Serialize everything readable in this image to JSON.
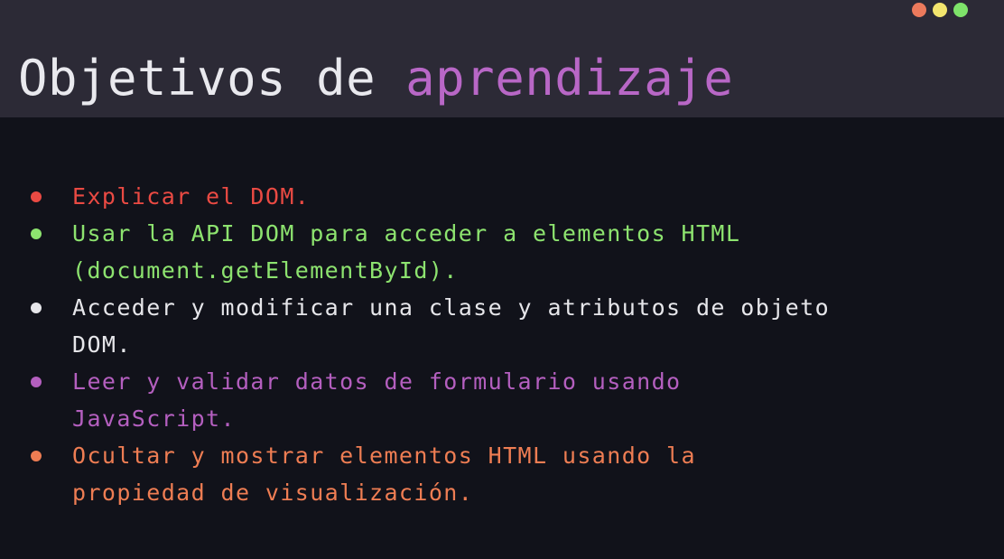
{
  "window_controls": {
    "colors": [
      "#ec7a5c",
      "#f3e56e",
      "#7ee36a"
    ]
  },
  "title": {
    "word_plain": "Objetivos de",
    "word_accent": "aprendizaje",
    "accent_color": "#b867c6"
  },
  "objectives": [
    {
      "text": "Explicar el DOM.",
      "color": "#ea4a43"
    },
    {
      "text": "Usar la API DOM para acceder a elementos HTML\n(document.getElementById).",
      "color": "#8de36f"
    },
    {
      "text": "Acceder y modificar una clase y atributos de objeto\nDOM.",
      "color": "#e6e6ea"
    },
    {
      "text": "Leer y validar datos de formulario usando\nJavaScript.",
      "color": "#b45fbf"
    },
    {
      "text": "Ocultar y mostrar elementos HTML usando la\npropiedad de visualización.",
      "color": "#ee7d53"
    }
  ]
}
